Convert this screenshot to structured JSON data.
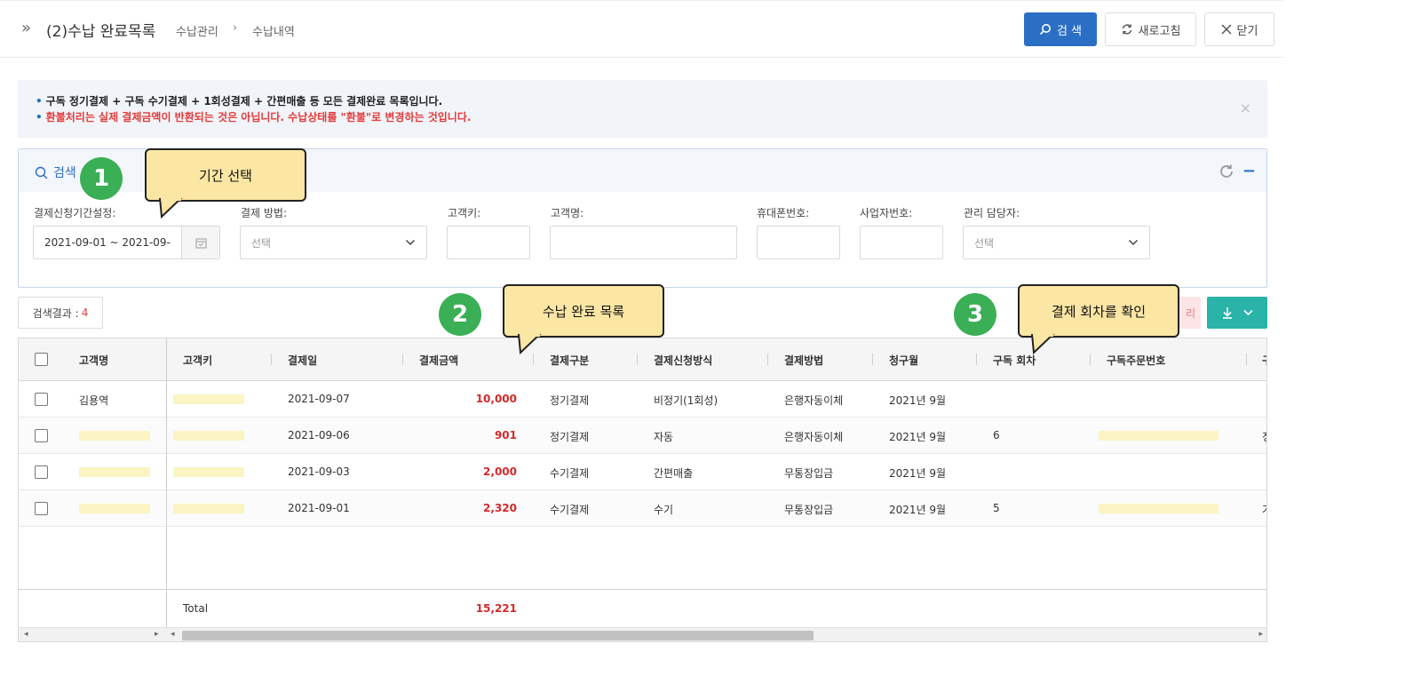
{
  "header": {
    "title": "(2)수납 완료목록",
    "breadcrumb": [
      "수납관리",
      "수납내역"
    ],
    "buttons": {
      "search": "검 색",
      "refresh": "새로고침",
      "close": "닫기"
    }
  },
  "notice": {
    "line1": "구독 정기결제 + 구독 수기결제 + 1회성결제 + 간편매출 등 모든 결제완료 목록입니다.",
    "line2": "환불처리는 실제 결제금액이 반환되는 것은 아닙니다. 수납상태를 \"환불\"로 변경하는 것입니다.",
    "close": "×"
  },
  "search_panel": {
    "title": "검색",
    "fields": {
      "period_label": "결제신청기간설정:",
      "period_value": "2021-09-01 ~ 2021-09-",
      "method_label": "결제 방법:",
      "method_value": "선택",
      "customer_key_label": "고객키:",
      "customer_name_label": "고객명:",
      "phone_label": "휴대폰번호:",
      "business_no_label": "사업자번호:",
      "manager_label": "관리 담당자:",
      "manager_value": "선택"
    }
  },
  "results": {
    "label": "검색결과 : ",
    "count": "4",
    "pink_btn": "리"
  },
  "grid": {
    "columns": [
      "고객명",
      "고객키",
      "결제일",
      "결제금액",
      "결제구분",
      "결제신청방식",
      "결제방법",
      "청구월",
      "구독 회차",
      "구독주문번호",
      "구"
    ],
    "rows": [
      {
        "name": "김용역",
        "date": "2021-09-07",
        "amount": "10,000",
        "type": "정기결제",
        "request": "비정기(1회성)",
        "method": "은행자동이체",
        "month": "2021년 9월",
        "round": "",
        "extra": ""
      },
      {
        "name": "",
        "date": "2021-09-06",
        "amount": "901",
        "type": "정기결제",
        "request": "자동",
        "method": "은행자동이체",
        "month": "2021년 9월",
        "round": "6",
        "extra": "정"
      },
      {
        "name": "",
        "date": "2021-09-03",
        "amount": "2,000",
        "type": "수기결제",
        "request": "간편매출",
        "method": "무통장입금",
        "month": "2021년 9월",
        "round": "",
        "extra": ""
      },
      {
        "name": "",
        "date": "2021-09-01",
        "amount": "2,320",
        "type": "수기결제",
        "request": "수기",
        "method": "무통장입금",
        "month": "2021년 9월",
        "round": "5",
        "extra": "가"
      }
    ],
    "footer": {
      "label": "Total",
      "amount": "15,221"
    }
  },
  "annotations": {
    "badge1": "1",
    "callout1": "기간 선택",
    "badge2": "2",
    "callout2": "수납 완료 목록",
    "badge3": "3",
    "callout3": "결제 회차를 확인"
  },
  "colors": {
    "primary": "#2a6fc4",
    "teal": "#2ab3a8",
    "amount_red": "#d42a2a",
    "badge_green": "#3aaf55",
    "callout_yellow": "#fbe6a4"
  }
}
